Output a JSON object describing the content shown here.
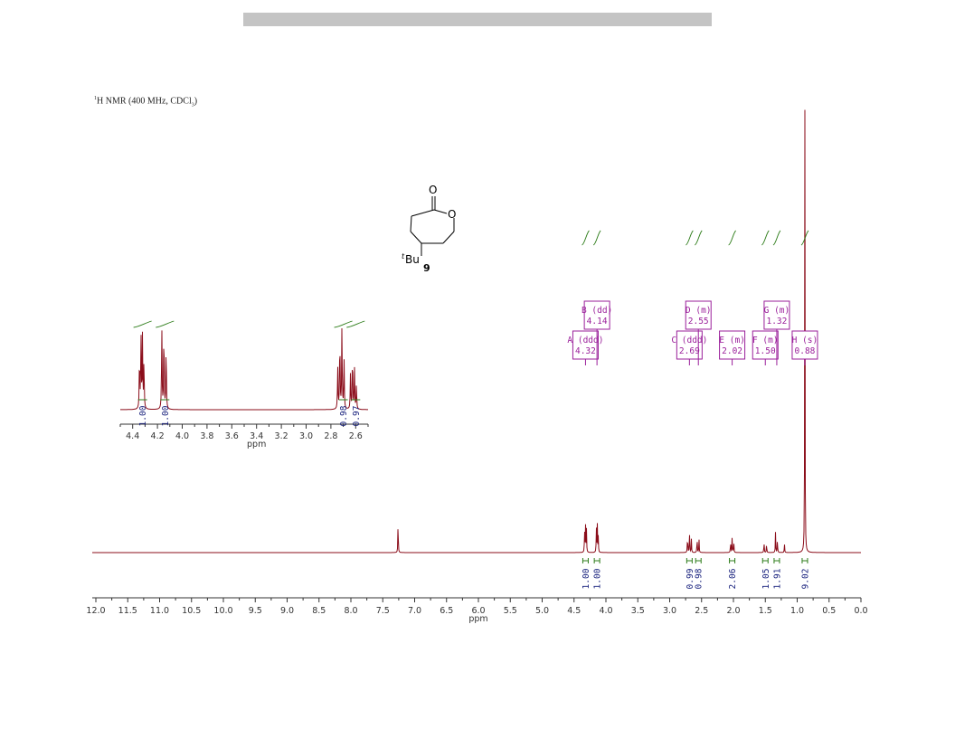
{
  "spectrum_title": {
    "pre": "1",
    "main": "H NMR (400 MHz, CDCl",
    "sub": "3",
    "post": ")"
  },
  "compound": {
    "oxygen_carbonyl": "O",
    "oxygen_ring": "O",
    "substituent_prefix": "t",
    "substituent": "Bu",
    "number": "9"
  },
  "colors": {
    "spectrum": "#8b0d1a",
    "integral": "#2e7d1a",
    "integral_value": "#1a237e",
    "peak_label": "#9a1f9a",
    "axis": "#333333",
    "header_bar": "#c4c4c4"
  },
  "chart_data": [
    {
      "type": "line",
      "title": "",
      "xlabel": "ppm",
      "ylabel": "",
      "xlim": [
        12.0,
        0.0
      ],
      "x_reversed": true,
      "x_ticks": [
        "12.0",
        "11.5",
        "11.0",
        "10.5",
        "10.0",
        "9.5",
        "9.0",
        "8.5",
        "8.0",
        "7.5",
        "7.0",
        "6.5",
        "6.0",
        "5.5",
        "5.0",
        "4.5",
        "4.0",
        "3.5",
        "3.0",
        "2.5",
        "2.0",
        "1.5",
        "1.0",
        "0.5",
        "0.0"
      ],
      "peaks": [
        {
          "shift": 7.26,
          "height": 0.075
        },
        {
          "shift": 4.335,
          "height": 0.05
        },
        {
          "shift": 4.32,
          "height": 0.06
        },
        {
          "shift": 4.305,
          "height": 0.05
        },
        {
          "shift": 4.15,
          "height": 0.055
        },
        {
          "shift": 4.135,
          "height": 0.06
        },
        {
          "shift": 4.12,
          "height": 0.035
        },
        {
          "shift": 2.72,
          "height": 0.04
        },
        {
          "shift": 2.69,
          "height": 0.05
        },
        {
          "shift": 2.66,
          "height": 0.03
        },
        {
          "shift": 2.57,
          "height": 0.035
        },
        {
          "shift": 2.54,
          "height": 0.03
        },
        {
          "shift": 2.045,
          "height": 0.025
        },
        {
          "shift": 2.02,
          "height": 0.035
        },
        {
          "shift": 1.995,
          "height": 0.025
        },
        {
          "shift": 1.52,
          "height": 0.025
        },
        {
          "shift": 1.48,
          "height": 0.02
        },
        {
          "shift": 1.34,
          "height": 0.045
        },
        {
          "shift": 1.31,
          "height": 0.03
        },
        {
          "shift": 1.2,
          "height": 0.02
        },
        {
          "shift": 0.88,
          "height": 1.0
        }
      ],
      "integrals": [
        {
          "shift": 4.32,
          "value": "1.00"
        },
        {
          "shift": 4.14,
          "value": "1.00"
        },
        {
          "shift": 2.69,
          "value": "0.99"
        },
        {
          "shift": 2.55,
          "value": "0.98"
        },
        {
          "shift": 2.02,
          "value": "2.06"
        },
        {
          "shift": 1.5,
          "value": "1.05"
        },
        {
          "shift": 1.32,
          "value": "1.91"
        },
        {
          "shift": 0.88,
          "value": "9.02"
        }
      ],
      "multiplets": [
        {
          "id": "A",
          "mult": "ddd",
          "shift": "4.32",
          "row": "lower"
        },
        {
          "id": "B",
          "mult": "dd",
          "shift": "4.14",
          "row": "upper"
        },
        {
          "id": "C",
          "mult": "ddd",
          "shift": "2.69",
          "row": "lower"
        },
        {
          "id": "D",
          "mult": "m",
          "shift": "2.55",
          "row": "upper"
        },
        {
          "id": "E",
          "mult": "m",
          "shift": "2.02",
          "row": "lower"
        },
        {
          "id": "F",
          "mult": "m",
          "shift": "1.50",
          "row": "lower"
        },
        {
          "id": "G",
          "mult": "m",
          "shift": "1.32",
          "row": "upper"
        },
        {
          "id": "H",
          "mult": "s",
          "shift": "0.88",
          "row": "lower"
        }
      ]
    },
    {
      "type": "line",
      "title": "",
      "xlabel": "ppm",
      "xlim": [
        4.5,
        2.5
      ],
      "x_reversed": true,
      "x_ticks": [
        "4.4",
        "4.2",
        "4.0",
        "3.8",
        "3.6",
        "3.4",
        "3.2",
        "3.0",
        "2.8",
        "2.6"
      ],
      "peaks": [
        {
          "shift": 4.345,
          "height": 0.62
        },
        {
          "shift": 4.333,
          "height": 0.92
        },
        {
          "shift": 4.321,
          "height": 0.86
        },
        {
          "shift": 4.309,
          "height": 0.6
        },
        {
          "shift": 4.165,
          "height": 1.0
        },
        {
          "shift": 4.148,
          "height": 0.98
        },
        {
          "shift": 4.13,
          "height": 0.78
        },
        {
          "shift": 2.745,
          "height": 0.5
        },
        {
          "shift": 2.728,
          "height": 0.88
        },
        {
          "shift": 2.711,
          "height": 1.0
        },
        {
          "shift": 2.694,
          "height": 0.6
        },
        {
          "shift": 2.642,
          "height": 0.42
        },
        {
          "shift": 2.626,
          "height": 0.66
        },
        {
          "shift": 2.61,
          "height": 0.5
        },
        {
          "shift": 2.594,
          "height": 0.3
        }
      ],
      "integrals": [
        {
          "shift": 4.32,
          "value": "1.00"
        },
        {
          "shift": 4.14,
          "value": "1.00"
        },
        {
          "shift": 2.7,
          "value": "0.98"
        },
        {
          "shift": 2.6,
          "value": "0.97"
        }
      ]
    }
  ]
}
